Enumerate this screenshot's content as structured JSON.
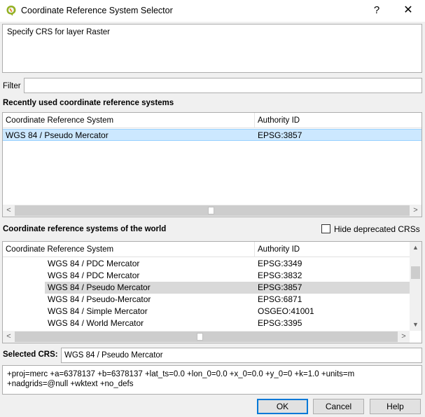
{
  "window": {
    "title": "Coordinate Reference System Selector",
    "help_glyph": "?",
    "close_glyph": "✕"
  },
  "message": "Specify CRS for layer Raster",
  "filter": {
    "label": "Filter",
    "value": "",
    "placeholder": ""
  },
  "recent": {
    "title": "Recently used coordinate reference systems",
    "headers": {
      "name": "Coordinate Reference System",
      "authority": "Authority ID"
    },
    "rows": [
      {
        "name": "WGS 84 / Pseudo Mercator",
        "authority": "EPSG:3857",
        "selected": true
      }
    ]
  },
  "world": {
    "title": "Coordinate reference systems of the world",
    "hide_deprecated_label": "Hide deprecated CRSs",
    "hide_deprecated_checked": false,
    "headers": {
      "name": "Coordinate Reference System",
      "authority": "Authority ID"
    },
    "rows": [
      {
        "name": "WGS 84 / PDC Mercator",
        "authority": "EPSG:3349"
      },
      {
        "name": "WGS 84 / PDC Mercator",
        "authority": "EPSG:3832"
      },
      {
        "name": "WGS 84 / Pseudo Mercator",
        "authority": "EPSG:3857",
        "selected": true
      },
      {
        "name": "WGS 84 / Pseudo-Mercator",
        "authority": "EPSG:6871"
      },
      {
        "name": "WGS 84 / Simple Mercator",
        "authority": "OSGEO:41001"
      },
      {
        "name": "WGS 84 / World Mercator",
        "authority": "EPSG:3395"
      }
    ]
  },
  "selected_crs": {
    "label": "Selected CRS:",
    "value": "WGS 84 / Pseudo Mercator"
  },
  "proj_string": "+proj=merc +a=6378137 +b=6378137 +lat_ts=0.0 +lon_0=0.0 +x_0=0.0 +y_0=0 +k=1.0 +units=m +nadgrids=@null +wktext +no_defs",
  "buttons": {
    "ok": "OK",
    "cancel": "Cancel",
    "help": "Help"
  },
  "scroll_glyphs": {
    "left": "<",
    "right": ">",
    "up": "▲",
    "down": "▼"
  },
  "colors": {
    "selected_active": "#cce8ff",
    "selected_inactive": "#d9d9d9",
    "accent": "#0078d7"
  }
}
